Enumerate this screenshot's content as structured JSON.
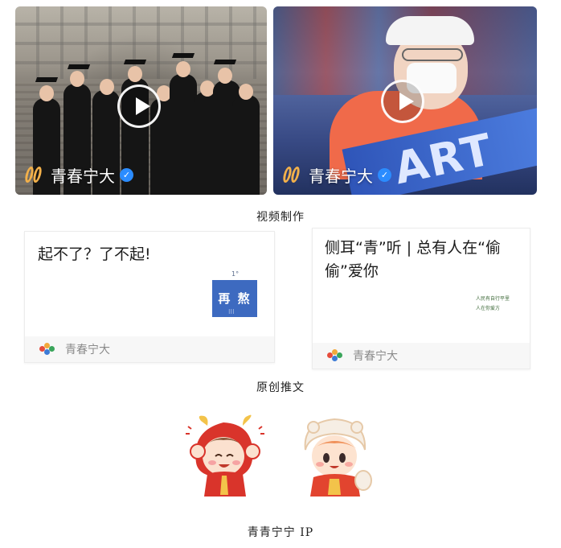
{
  "videos": [
    {
      "channel_name": "青春宁大",
      "play_icon": "play-icon",
      "verified_icon": "check-icon"
    },
    {
      "channel_name": "青春宁大",
      "play_icon": "play-icon",
      "verified_icon": "check-icon",
      "banner_text": "ART"
    }
  ],
  "section_captions": {
    "video": "视频制作",
    "articles": "原创推文",
    "ip": "青青宁宁 IP"
  },
  "articles": [
    {
      "title": "起不了？了不起!",
      "thumb_text": "再 熬",
      "thumb_dots": "⁝⁝⁝",
      "footer_name": "青春宁大"
    },
    {
      "title": "侧耳“青”听 | 总有人在“偷偷”爱你",
      "thumb_text": "人民有自行平里\n人在你爱方",
      "footer_name": "青春宁大"
    }
  ],
  "colors": {
    "brand_orange": "#f2b04a",
    "verified_blue": "#2b8cff",
    "ip_red": "#d9342b"
  }
}
